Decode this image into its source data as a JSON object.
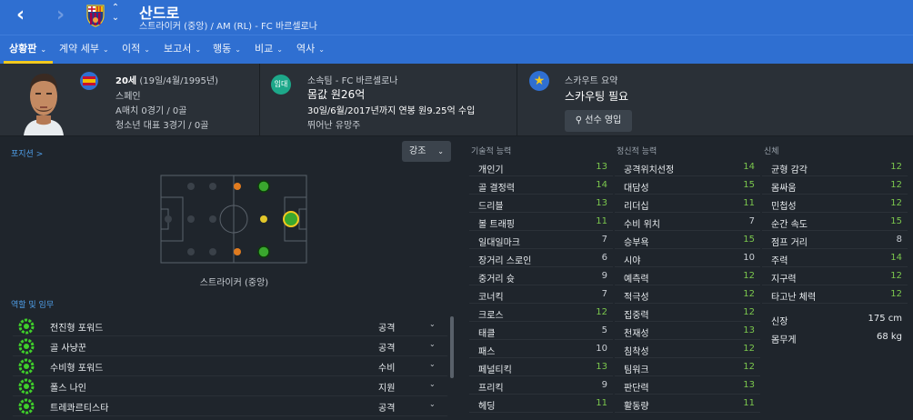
{
  "header": {
    "player_name": "산드로",
    "subtitle": "스트라이커 (중앙) / AM (RL) - FC 바르셀로나",
    "back_icon": "chevron-left-icon",
    "forward_icon": "chevron-right-icon"
  },
  "tabs": [
    {
      "label": "상황판",
      "caret": "⌄"
    },
    {
      "label": "계약 세부",
      "caret": "⌄"
    },
    {
      "label": "이적",
      "caret": "⌄"
    },
    {
      "label": "보고서",
      "caret": "⌄"
    },
    {
      "label": "행동",
      "caret": "⌄"
    },
    {
      "label": "비교",
      "caret": "⌄"
    },
    {
      "label": "역사",
      "caret": "⌄"
    }
  ],
  "profile": {
    "age": "20세",
    "birth": "(19일/4월/1995년)",
    "nationality": "스페인",
    "a_caps": "A매치 0경기 / 0골",
    "youth_caps": "청소년 대표 3경기 / 0골"
  },
  "club": {
    "loan_badge": "임대",
    "club_line": "소속팀 - FC 바르셀로나",
    "value": "몸값 원26억",
    "contract": "30일/6월/2017년까지 연봉 원9.25억 수입",
    "potential": "뛰어난 유망주"
  },
  "scout": {
    "title": "스카우트 요약",
    "status": "스카우팅 필요",
    "sign_button": "선수 영입",
    "search_icon": "search-icon"
  },
  "position": {
    "title": "포지션 >",
    "emphasis_button": "강조",
    "position_label": "스트라이커 (중앙)"
  },
  "roles": {
    "title": "역할 및 임무",
    "items": [
      {
        "name": "전진형 포워드",
        "duty": "공격"
      },
      {
        "name": "골 사냥꾼",
        "duty": "공격"
      },
      {
        "name": "수비형 포워드",
        "duty": "수비"
      },
      {
        "name": "폴스 나인",
        "duty": "지원"
      },
      {
        "name": "트레콰르티스타",
        "duty": "공격"
      }
    ]
  },
  "technical": {
    "title": "기술적 능력",
    "items": [
      {
        "name": "개인기",
        "value": "13",
        "high": true
      },
      {
        "name": "골 결정력",
        "value": "14",
        "high": true
      },
      {
        "name": "드리블",
        "value": "13",
        "high": true
      },
      {
        "name": "볼 트래핑",
        "value": "11",
        "high": true
      },
      {
        "name": "일대일마크",
        "value": "7",
        "high": false
      },
      {
        "name": "장거리 스로인",
        "value": "6",
        "high": false
      },
      {
        "name": "중거리 슛",
        "value": "9",
        "high": false
      },
      {
        "name": "코너킥",
        "value": "7",
        "high": false
      },
      {
        "name": "크로스",
        "value": "12",
        "high": true
      },
      {
        "name": "태클",
        "value": "5",
        "high": false
      },
      {
        "name": "패스",
        "value": "10",
        "high": false
      },
      {
        "name": "페널티킥",
        "value": "13",
        "high": true
      },
      {
        "name": "프리킥",
        "value": "9",
        "high": false
      },
      {
        "name": "헤딩",
        "value": "11",
        "high": true
      }
    ]
  },
  "mental": {
    "title": "정신적 능력",
    "items": [
      {
        "name": "공격위치선정",
        "value": "14",
        "high": true
      },
      {
        "name": "대담성",
        "value": "15",
        "high": true
      },
      {
        "name": "리더십",
        "value": "11",
        "high": true
      },
      {
        "name": "수비 위치",
        "value": "7",
        "high": false
      },
      {
        "name": "승부욕",
        "value": "15",
        "high": true
      },
      {
        "name": "시야",
        "value": "10",
        "high": false
      },
      {
        "name": "예측력",
        "value": "12",
        "high": true
      },
      {
        "name": "적극성",
        "value": "12",
        "high": true
      },
      {
        "name": "집중력",
        "value": "12",
        "high": true
      },
      {
        "name": "천재성",
        "value": "13",
        "high": true
      },
      {
        "name": "침착성",
        "value": "12",
        "high": true
      },
      {
        "name": "팀워크",
        "value": "12",
        "high": true
      },
      {
        "name": "판단력",
        "value": "13",
        "high": true
      },
      {
        "name": "활동량",
        "value": "11",
        "high": true
      }
    ]
  },
  "physical": {
    "title": "신체",
    "items": [
      {
        "name": "균형 감각",
        "value": "12",
        "high": true
      },
      {
        "name": "몸싸움",
        "value": "12",
        "high": true
      },
      {
        "name": "민첩성",
        "value": "12",
        "high": true
      },
      {
        "name": "순간 속도",
        "value": "15",
        "high": true
      },
      {
        "name": "점프 거리",
        "value": "8",
        "high": false
      },
      {
        "name": "주력",
        "value": "14",
        "high": true
      },
      {
        "name": "지구력",
        "value": "12",
        "high": true
      },
      {
        "name": "타고난 체력",
        "value": "12",
        "high": true
      }
    ],
    "extras": [
      {
        "name": "신장",
        "value": "175 cm"
      },
      {
        "name": "몸무게",
        "value": "68 kg"
      }
    ]
  },
  "colors": {
    "accent": "#2f6fd1",
    "highlight": "#f2c91f",
    "attr_high": "#7bc74d",
    "attr_normal": "#c9ced4"
  }
}
